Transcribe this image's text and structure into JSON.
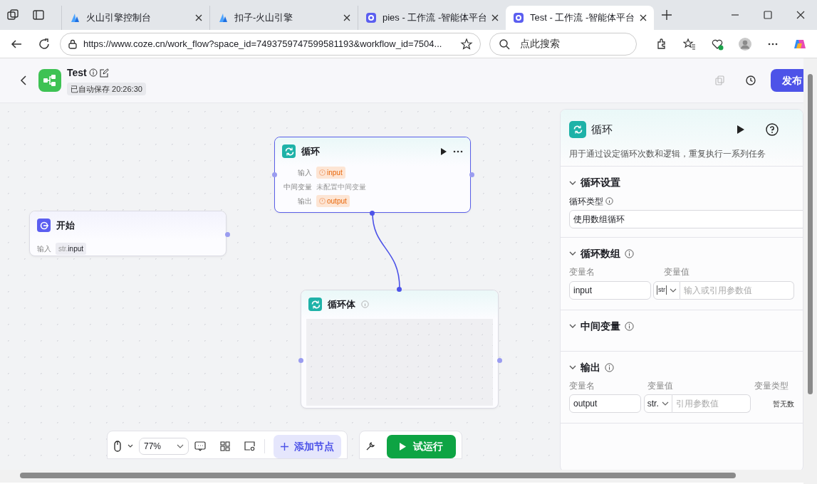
{
  "browser": {
    "tabs": [
      {
        "title": "火山引擎控制台",
        "kind": "volcano",
        "selected": false
      },
      {
        "title": "扣子-火山引擎",
        "kind": "volcano",
        "selected": false
      },
      {
        "title": "pies - 工作流 -智能体平台",
        "kind": "coze",
        "selected": false
      },
      {
        "title": "Test - 工作流 -智能体平台",
        "kind": "coze",
        "selected": true
      }
    ],
    "url": "https://www.coze.cn/work_flow?space_id=7493759747599581193&workflow_id=7504...",
    "search": {
      "placeholder": "点此搜索"
    }
  },
  "header": {
    "title": "Test",
    "saved": "已自动保存 20:26:30",
    "publish": "发布"
  },
  "nodes": [
    {
      "kind": "start",
      "title": "开始",
      "rows": [
        {
          "label": "输入",
          "kind": "typed",
          "type": "str.",
          "value": "input"
        }
      ]
    },
    {
      "kind": "loop",
      "title": "循环",
      "rows": [
        {
          "label": "输入",
          "kind": "warning",
          "value": "input"
        },
        {
          "label": "中间变量",
          "kind": "plain",
          "value": "未配置中间变量"
        },
        {
          "label": "输出",
          "kind": "warning",
          "value": "output"
        }
      ]
    },
    {
      "kind": "body",
      "title": "循环体"
    }
  ],
  "panel": {
    "title": "循环",
    "description": "用于通过设定循环次数和逻辑，重复执行一系列任务",
    "sections": [
      {
        "title": "循环设置",
        "expanded": true,
        "hint_icon": false,
        "kind": "select",
        "label": "循环类型",
        "value": "使用数组循环"
      },
      {
        "title": "循环数组",
        "expanded": true,
        "hint_icon": true,
        "kind": "params",
        "columns": [
          "变量名",
          "变量值"
        ],
        "rows": [
          {
            "name": "input",
            "type": "str",
            "placeholder": "输入或引用参数值"
          }
        ]
      },
      {
        "title": "中间变量",
        "expanded": true,
        "hint_icon": true,
        "kind": "empty"
      },
      {
        "title": "输出",
        "expanded": true,
        "hint_icon": true,
        "kind": "params",
        "columns": [
          "变量名",
          "变量值",
          "变量类型"
        ],
        "rows": [
          {
            "name": "output",
            "type": "str.",
            "placeholder": "引用参数值",
            "type_text": "暂无数"
          }
        ]
      }
    ]
  },
  "toolbar": {
    "zoom": "77%",
    "add": "添加节点",
    "run": "试运行"
  }
}
